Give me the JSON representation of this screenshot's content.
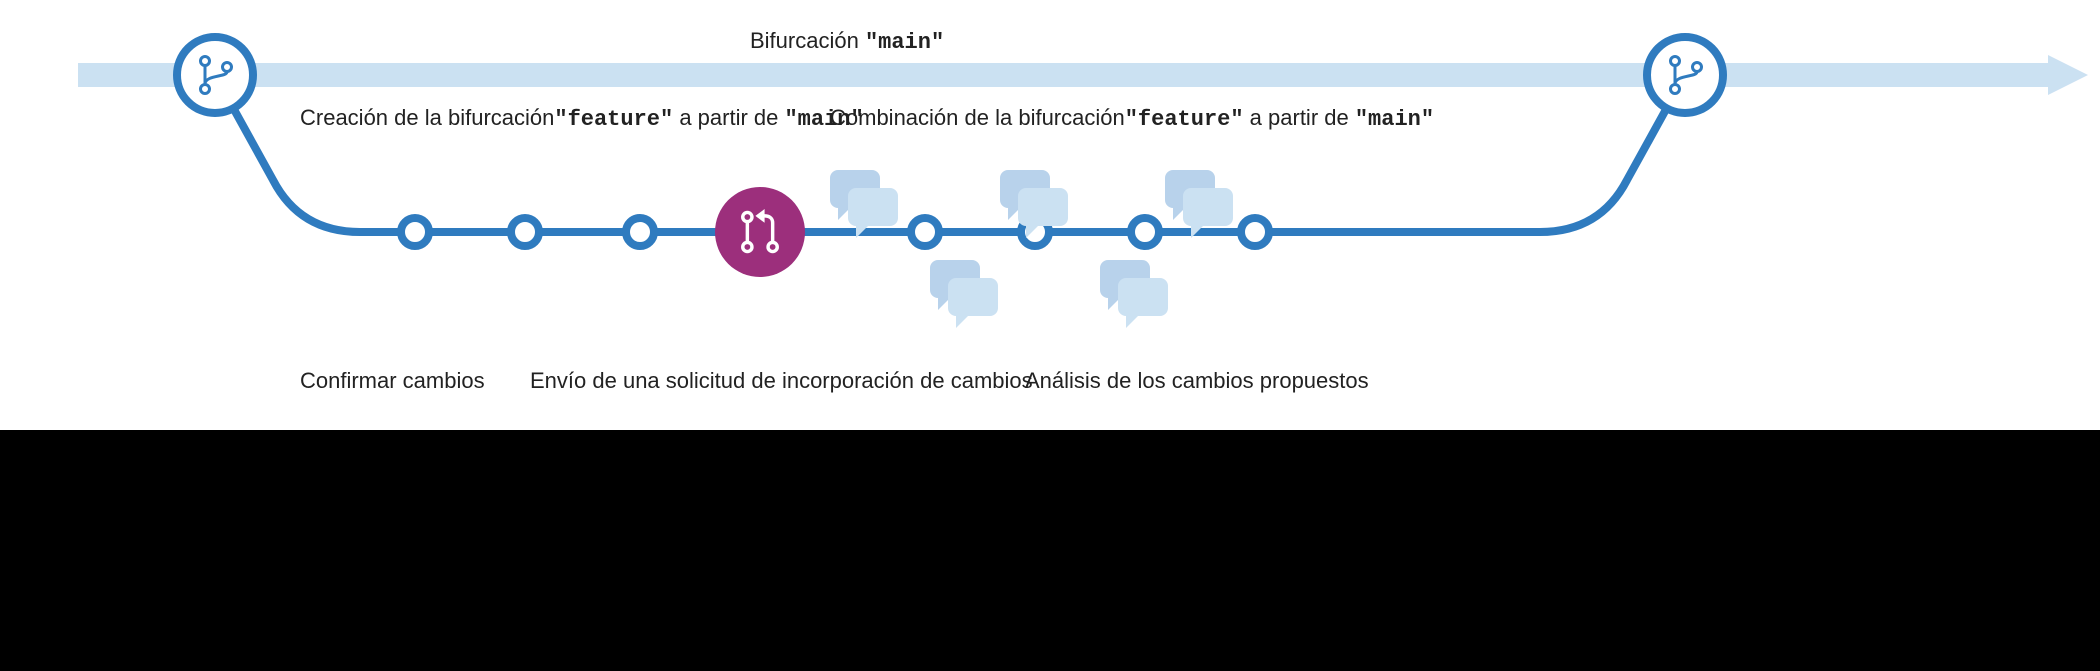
{
  "colors": {
    "blue": "#2F7BBF",
    "lightblue": "#CBE1F2",
    "purple": "#9C2F7C",
    "iconfill": "#B8D2EB",
    "text": "#222222"
  },
  "main_label": {
    "prefix": "Bifurcación ",
    "name": "\"main\""
  },
  "create_label": {
    "prefix": "Creación de la bifurcación",
    "name": "\"feature\"",
    "mid": " a partir de ",
    "target": "\"main\""
  },
  "merge_label": {
    "prefix": "Combinación de la bifurcación",
    "name": "\"feature\"",
    "mid": " a partir de ",
    "target": "\"main\""
  },
  "commit_label": "Confirmar cambios",
  "pr_label": "Envío de una solicitud de incorporación de cambios",
  "review_label": "Análisis de los cambios propuestos"
}
